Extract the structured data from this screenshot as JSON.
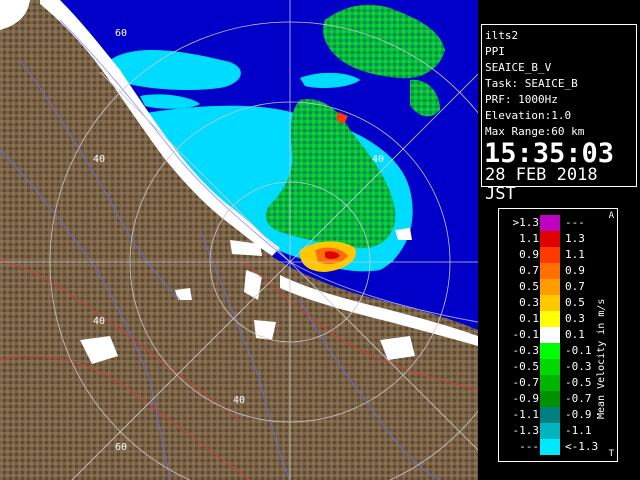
{
  "map": {
    "range_labels": [
      "60",
      "40",
      "40",
      "40",
      "40",
      "60"
    ],
    "colors": {
      "sea": "#0000c8",
      "land": "#7a6347",
      "shore_ice": "#ffffff",
      "echo_cyan": "#00e0ff",
      "echo_green": "#10c020"
    }
  },
  "info": {
    "site": "ilts2",
    "scan": "PPI",
    "product": "SEAICE_B_V",
    "task": "Task: SEAICE_B",
    "prf": "PRF: 1000Hz",
    "elevation": "Elevation:1.0",
    "max_range": "Max Range:60 km",
    "time": "15:35:03",
    "date": "28 FEB 2018 JST"
  },
  "legend": {
    "title": "Mean Velocity in m/s",
    "top_marker": "A",
    "bottom_marker": "T",
    "rows": [
      {
        "left": ">1.3",
        "right": "---",
        "color": "#c000c0"
      },
      {
        "left": "1.1",
        "right": "1.3",
        "color": "#e00000"
      },
      {
        "left": "0.9",
        "right": "1.1",
        "color": "#ff3a00"
      },
      {
        "left": "0.7",
        "right": "0.9",
        "color": "#ff7000"
      },
      {
        "left": "0.5",
        "right": "0.7",
        "color": "#ff9c00"
      },
      {
        "left": "0.3",
        "right": "0.5",
        "color": "#ffc800"
      },
      {
        "left": "0.1",
        "right": "0.3",
        "color": "#ffff00"
      },
      {
        "left": "-0.1",
        "right": "0.1",
        "color": "#ffffff"
      },
      {
        "left": "-0.3",
        "right": "-0.1",
        "color": "#00ff00"
      },
      {
        "left": "-0.5",
        "right": "-0.3",
        "color": "#00d800"
      },
      {
        "left": "-0.7",
        "right": "-0.5",
        "color": "#00b400"
      },
      {
        "left": "-0.9",
        "right": "-0.7",
        "color": "#009000"
      },
      {
        "left": "-1.1",
        "right": "-0.9",
        "color": "#008080"
      },
      {
        "left": "-1.3",
        "right": "-1.1",
        "color": "#00b4c0"
      },
      {
        "left": "---",
        "right": "<-1.3",
        "color": "#00e8ff"
      }
    ]
  }
}
